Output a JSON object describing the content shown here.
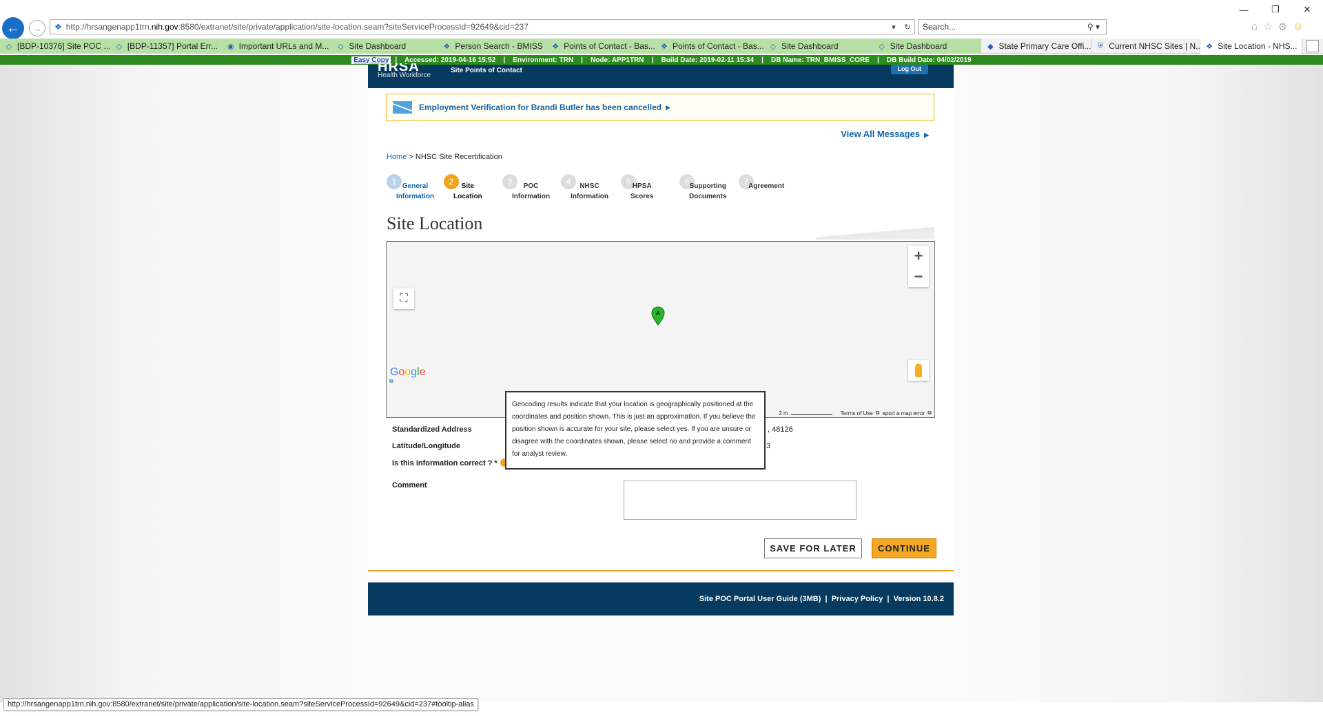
{
  "browser": {
    "url_prefix": "http://hrsangenapp1trn.",
    "url_domain": "nih.gov",
    "url_suffix": ":8580/extranet/site/private/application/site-location.seam?siteServiceProcessId=92649&cid=237",
    "search_placeholder": "Search...",
    "status_url": "http://hrsangenapp1trn.nih.gov:8580/extranet/site/private/application/site-location.seam?siteServiceProcessId=92649&cid=237#tooltip-alias"
  },
  "tabs": [
    {
      "label": "[BDP-10376] Site POC ...",
      "icon": "jira-icon"
    },
    {
      "label": "[BDP-11357] Portal Err...",
      "icon": "jira-icon"
    },
    {
      "label": "Important URLs and M...",
      "icon": "web-icon"
    },
    {
      "label": "Site Dashboard",
      "icon": "page-icon"
    },
    {
      "label": "Person Search - BMISS",
      "icon": "page-icon"
    },
    {
      "label": "Points of Contact - Bas...",
      "icon": "page-icon"
    },
    {
      "label": "Points of Contact - Bas...",
      "icon": "page-icon"
    },
    {
      "label": "Site Dashboard",
      "icon": "page-icon"
    },
    {
      "label": "Site Dashboard",
      "icon": "page-icon"
    },
    {
      "label": "State Primary Care Offi...",
      "icon": "hrsa-icon"
    },
    {
      "label": "Current NHSC Sites | N...",
      "icon": "shield-icon"
    },
    {
      "label": "Site Location - NHS...",
      "icon": "page-icon"
    }
  ],
  "envbar": {
    "easy_copy": "Easy Copy",
    "info": "|    Accessed: 2019-04-16 15:52    |    Environment: TRN    |    Node: APP1TRN    |    Build Date: 2019-02-11 15:34    |    DB Name: TRN_BMISS_CORE    |    DB Build Date: 04/02/2019"
  },
  "header": {
    "logo": "HRSA",
    "logo_sub": "Health Workforce",
    "portal_name": "Site Points of Contact",
    "logout": "Log Out"
  },
  "message": {
    "text": "Employment Verification for Brandi Butler has been cancelled",
    "view_all": "View All Messages"
  },
  "breadcrumb": {
    "home": "Home",
    "separator": ">",
    "current": "NHSC Site Recertification"
  },
  "steps": [
    {
      "num": "1",
      "label1": "General",
      "label2": "Information",
      "state": "done"
    },
    {
      "num": "2",
      "label1": "Site",
      "label2": "Location",
      "state": "current"
    },
    {
      "num": "3",
      "label1": "POC",
      "label2": "Information",
      "state": "todo"
    },
    {
      "num": "4",
      "label1": "NHSC",
      "label2": "Information",
      "state": "todo"
    },
    {
      "num": "5",
      "label1": "HPSA",
      "label2": "Scores",
      "state": "todo"
    },
    {
      "num": "6",
      "label1": "Supporting",
      "label2": "Documents",
      "state": "todo"
    },
    {
      "num": "7",
      "label1": "Agreement",
      "label2": "",
      "state": "todo"
    }
  ],
  "page_title": "Site Location",
  "map": {
    "marker_label": "A",
    "google": [
      "G",
      "o",
      "o",
      "g",
      "l",
      "e"
    ],
    "scale": "2 m",
    "terms": "Terms of Use",
    "report": "eport a map error"
  },
  "form": {
    "standardized_address_label": "Standardized Address",
    "standardized_address_value": ", 48126",
    "latlong_label": "Latitude/Longitude",
    "latlong_value": "3",
    "correct_label": "Is this information correct ? *",
    "comment_label": "Comment"
  },
  "buttons": {
    "save": "SAVE FOR LATER",
    "continue": "CONTINUE"
  },
  "footer": {
    "links": "Site POC Portal User Guide (3MB)  |  Privacy Policy  |  Version 10.8.2"
  },
  "tooltip": {
    "text": "Geocoding results indicate that your location is geographically positioned at the coordinates and position shown. This is just an approximation. If you believe the position shown is accurate for your site, please select yes. If you are unsure or disagree with the coordinates shown, please select no and provide a comment for analyst review."
  },
  "colors": {
    "brand_navy": "#063a5f",
    "accent_orange": "#f0a41c",
    "link_blue": "#1264a8",
    "env_green": "#2d8a1e"
  }
}
